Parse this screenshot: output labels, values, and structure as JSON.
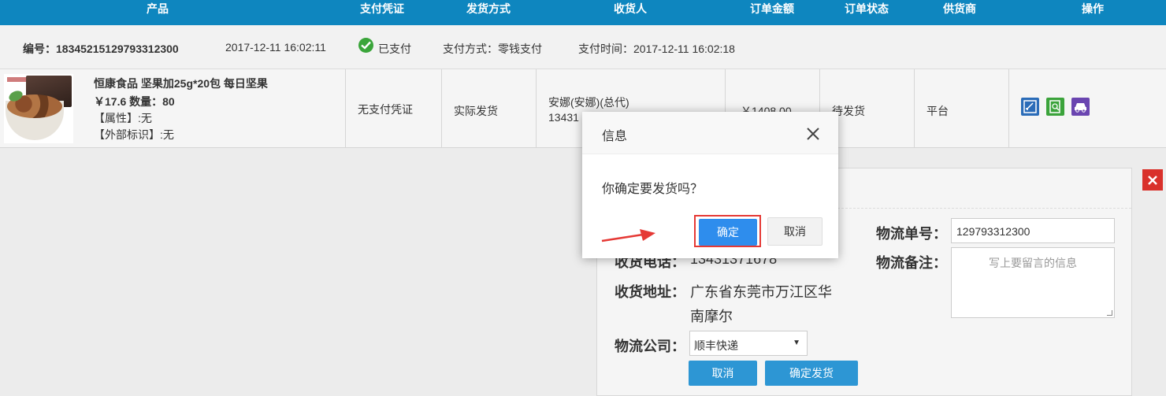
{
  "table_header": {
    "product": "产品",
    "payment_proof": "支付凭证",
    "shipping_method": "发货方式",
    "receiver": "收货人",
    "order_amount": "订单金额",
    "order_status": "订单状态",
    "supplier": "供货商",
    "operation": "操作"
  },
  "order": {
    "number": "编号：18345215129793312300",
    "created_time": "2017-12-11 16:02:11",
    "paid_status": "已支付",
    "payment_method": "支付方式：零钱支付",
    "payment_time": "支付时间：2017-12-11 16:02:18"
  },
  "product": {
    "title": "恒康食品 坚果加25g*20包 每日坚果",
    "price_qty": "￥17.6 数量：80",
    "attribute": "【属性】:无",
    "external_mark": "【外部标识】:无",
    "payment_proof": "无支付凭证",
    "shipping_method": "实际发货",
    "receiver_name": "安娜(安娜)(总代)",
    "receiver_phone_partial": "13431",
    "amount": "￥1408.00",
    "status": "待发货",
    "supplier": "平台",
    "actions": [
      "edit-icon",
      "receipt-icon",
      "truck-icon"
    ]
  },
  "ship_panel": {
    "phone_label": "收货电话：",
    "phone_value": "13431371678",
    "address_label": "收货地址：",
    "address_line1": "广东省东莞市万江区华",
    "address_line2": "南摩尔",
    "logistics_company_label": "物流公司：",
    "logistics_company_value": "顺丰快递",
    "tracking_label": "物流单号：",
    "tracking_value": "129793312300",
    "note_label": "物流备注：",
    "note_placeholder": "写上要留言的信息",
    "cancel_label": "取消",
    "confirm_label": "确定发货"
  },
  "dialog": {
    "title": "信息",
    "message": "你确定要发货吗？",
    "ok_label": "确定",
    "cancel_label": "取消"
  },
  "colors": {
    "header_bg": "#0e86bf",
    "ok_button": "#2e8ded",
    "highlight": "#e53935",
    "paid_green": "#3aa53a"
  }
}
